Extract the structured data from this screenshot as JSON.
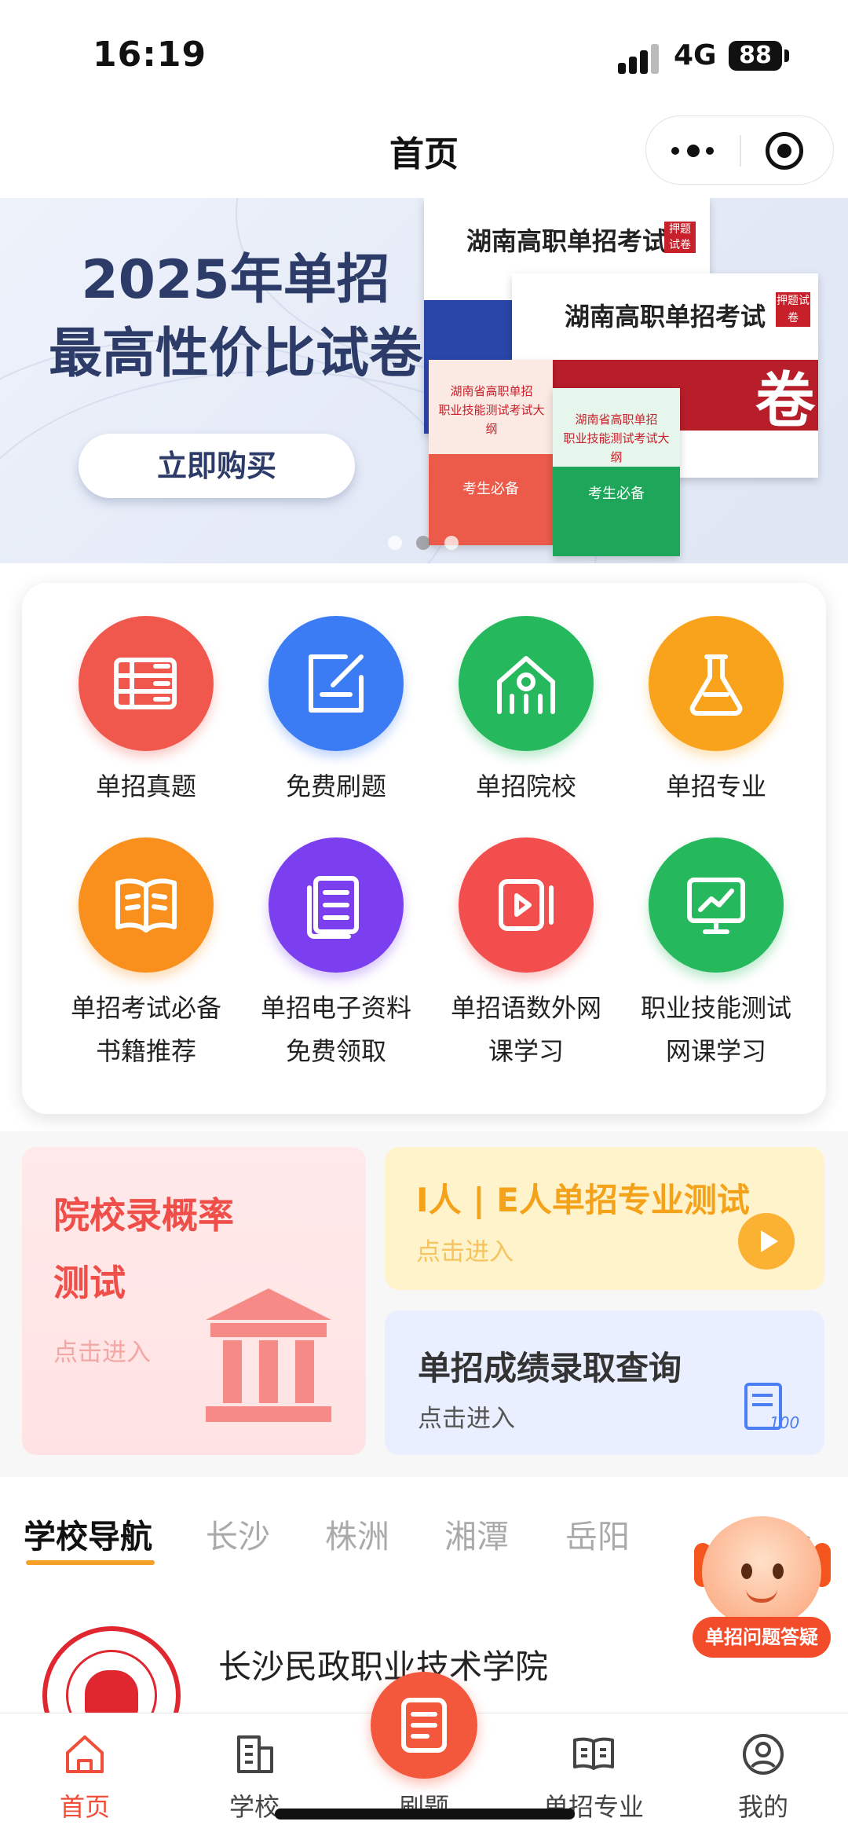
{
  "status_bar": {
    "time": "16:19",
    "network": "4G",
    "battery": "88"
  },
  "nav": {
    "title": "首页"
  },
  "banner": {
    "headline_line1": "2025年单招",
    "headline_line2": "最高性价比试卷",
    "buy_button": "立即购买",
    "book_title": "湖南高职单招考试",
    "book_tag": "押题试卷",
    "book_small_1": "湖南省高职单招",
    "book_small_2": "职业技能测试考试大纲",
    "book_badge": "考生必备",
    "book_big_char": "卷",
    "page_count": 3,
    "active_page": 1
  },
  "features": [
    {
      "label": "单招真题",
      "icon": "books-icon",
      "color": "#f0584e"
    },
    {
      "label": "免费刷题",
      "icon": "edit-icon",
      "color": "#3b7cf5"
    },
    {
      "label": "单招院校",
      "icon": "school-icon",
      "color": "#26b85c"
    },
    {
      "label": "单招专业",
      "icon": "flask-icon",
      "color": "#f9a21c"
    },
    {
      "label": "单招考试必备书籍推荐",
      "line1": "单招考试必备",
      "line2": "书籍推荐",
      "icon": "open-book-icon",
      "color": "#f98f1c"
    },
    {
      "label": "单招电子资料免费领取",
      "line1": "单招电子资料",
      "line2": "免费领取",
      "icon": "document-icon",
      "color": "#7b3ff0"
    },
    {
      "label": "单招语数外网课学习",
      "line1": "单招语数外网",
      "line2": "课学习",
      "icon": "video-icon",
      "color": "#f24e4e"
    },
    {
      "label": "职业技能测试网课学习",
      "line1": "职业技能测试",
      "line2": "网课学习",
      "icon": "chart-screen-icon",
      "color": "#26b85c"
    }
  ],
  "promos": {
    "admission": {
      "title_line1": "院校录概率",
      "title_line2": "测试",
      "sub": "点击进入"
    },
    "mbti": {
      "title": "I人 | E人单招专业测试",
      "sub": "点击进入"
    },
    "score": {
      "title": "单招成绩录取查询",
      "sub": "点击进入"
    }
  },
  "school_nav": {
    "tabs": [
      "学校导航",
      "长沙",
      "株洲",
      "湘潭",
      "岳阳"
    ],
    "active_tab": 0,
    "more": "更多 >"
  },
  "school_list": [
    {
      "name": "长沙民政职业技术学院"
    }
  ],
  "mascot": {
    "label": "单招问题答疑"
  },
  "tabbar": {
    "items": [
      {
        "label": "首页",
        "icon": "home-icon"
      },
      {
        "label": "学校",
        "icon": "building-icon"
      },
      {
        "label": "刷题",
        "icon": "exam-paper-icon"
      },
      {
        "label": "单招专业",
        "icon": "open-book-icon"
      },
      {
        "label": "我的",
        "icon": "user-icon"
      }
    ],
    "active": 0,
    "accent": "#f04e38"
  }
}
